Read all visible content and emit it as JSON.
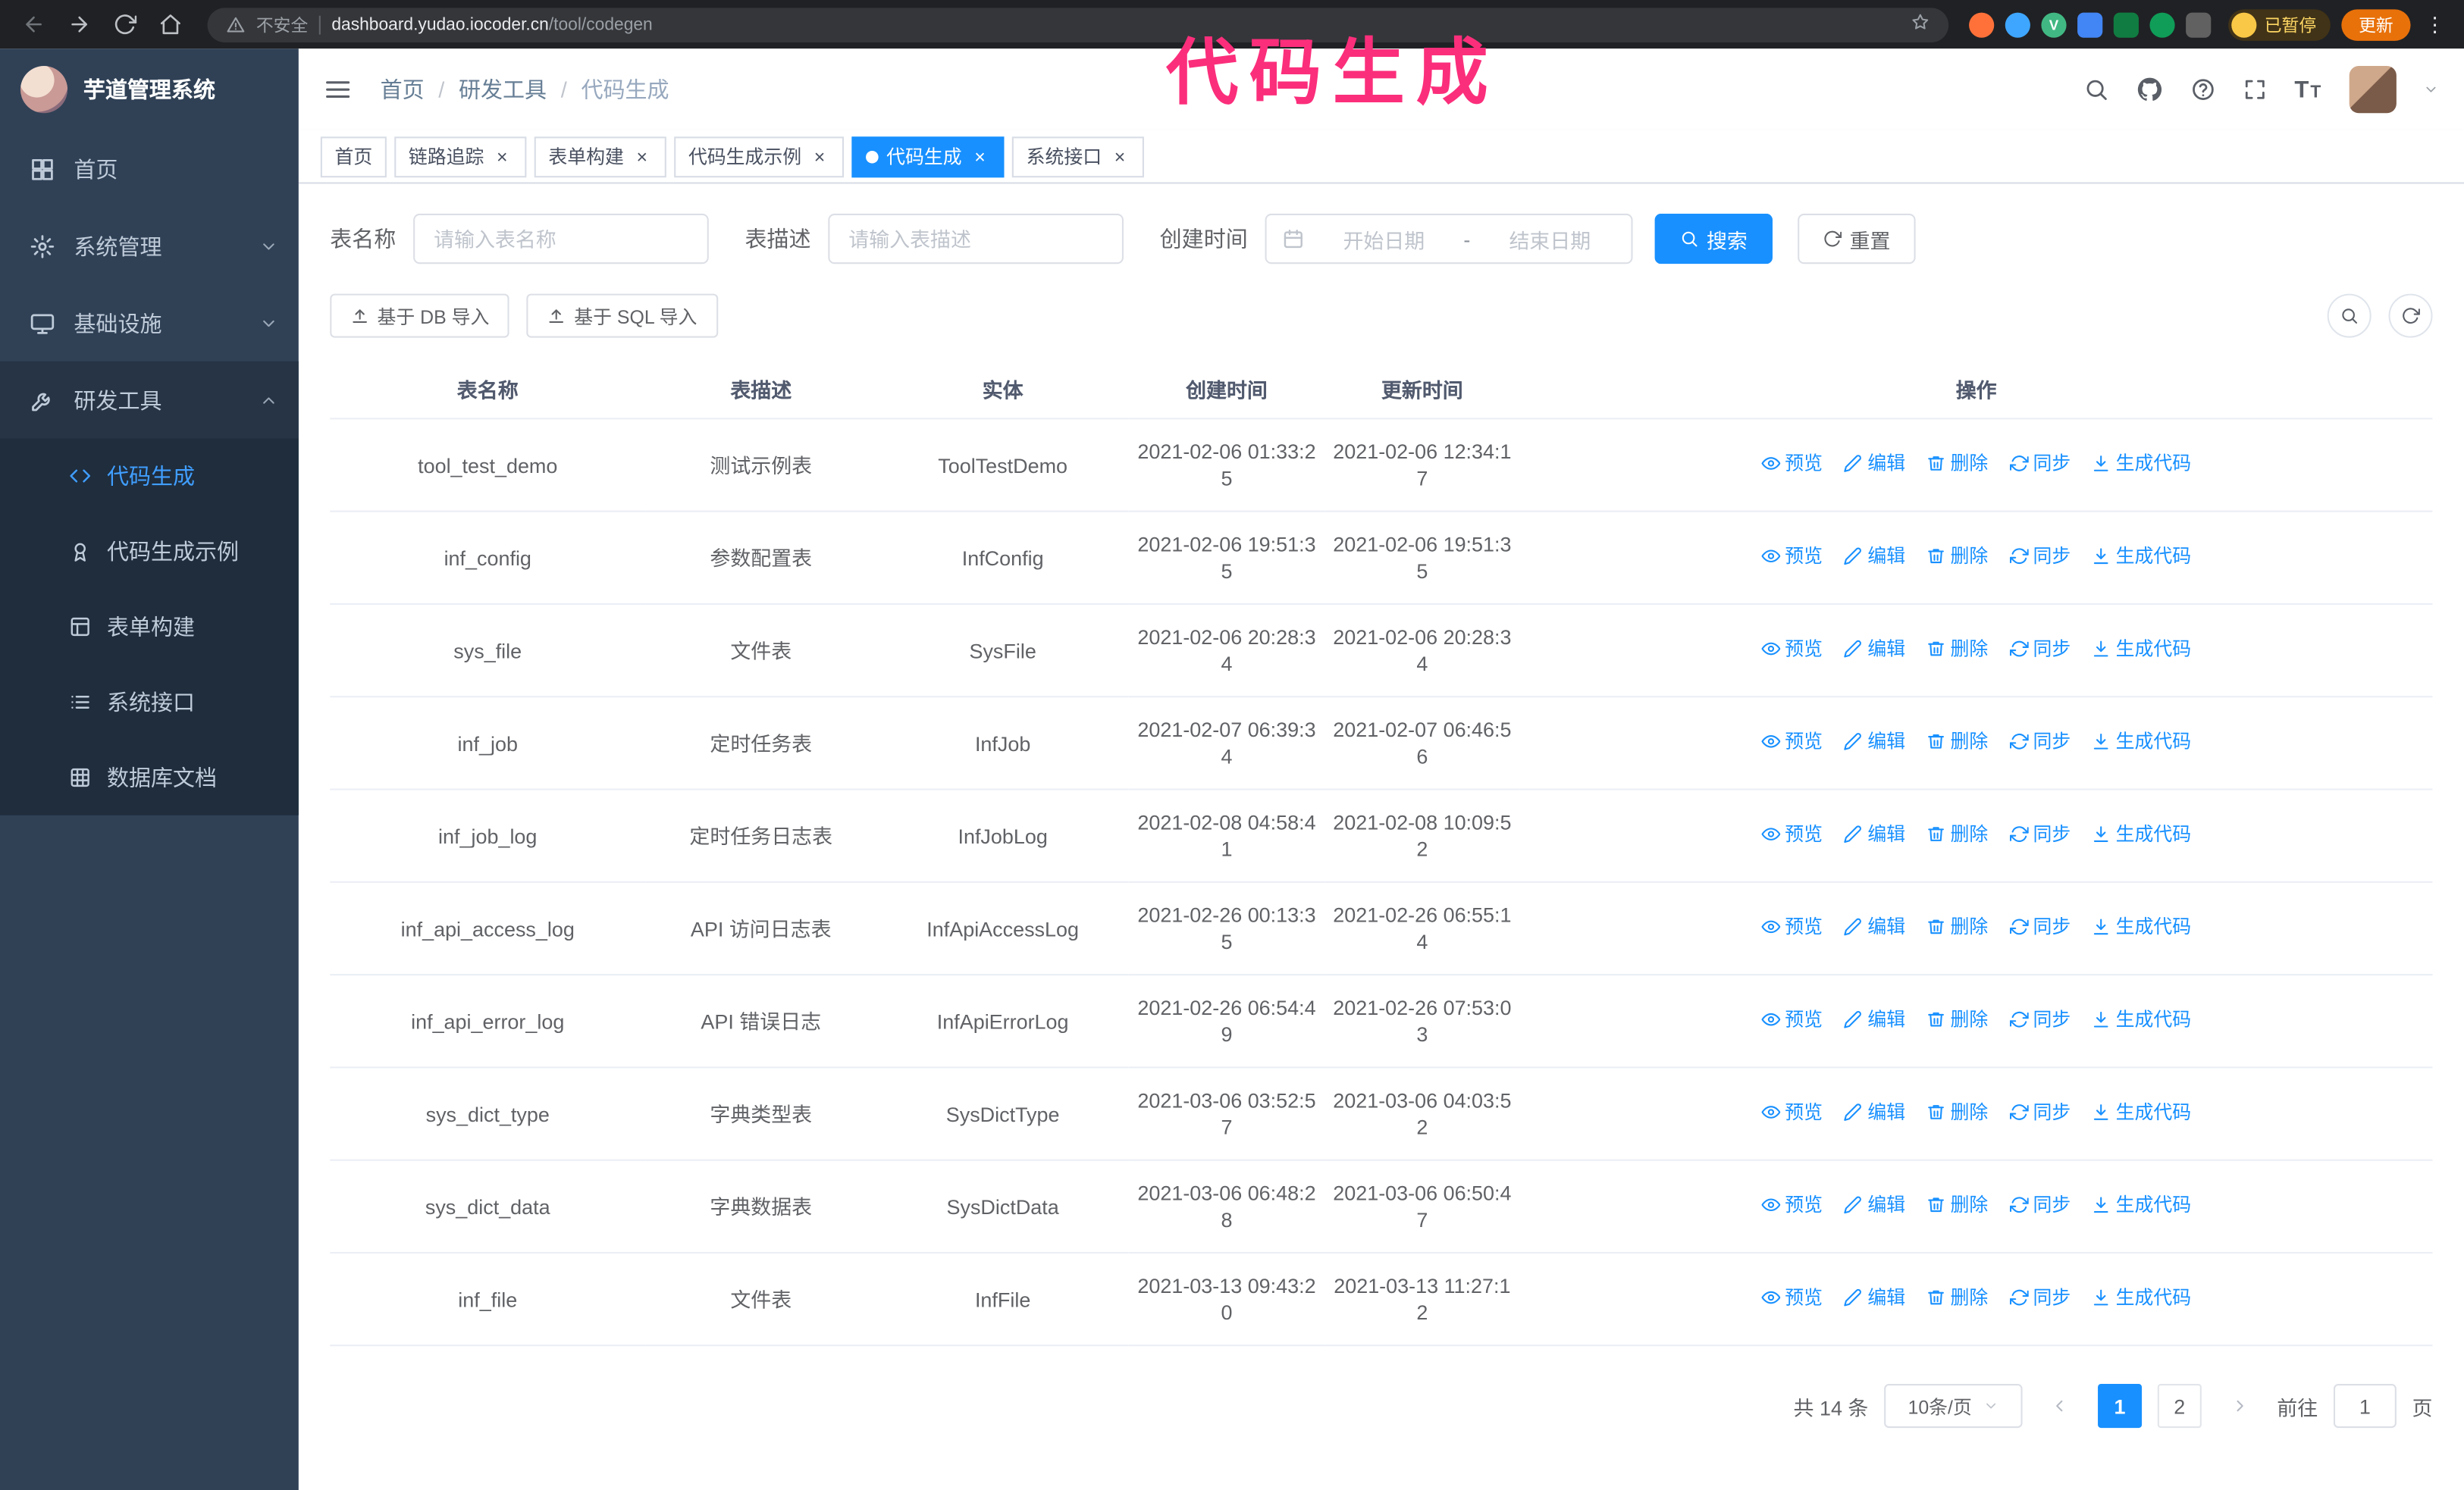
{
  "annotation": "代码生成",
  "colors": {
    "accent": "#1890ff",
    "annotation_pink": "#fb2e7b",
    "sidebar_bg": "#304156",
    "active_tab_bg": "#1890ff"
  },
  "browser": {
    "security_label": "不安全",
    "url_host": "dashboard.yudao.iocoder.cn",
    "url_path": "/tool/codegen",
    "paused_badge": "已暂停",
    "update_button": "更新"
  },
  "app_title": "芋道管理系统",
  "menu": {
    "items": [
      {
        "label": "首页",
        "icon": "grid-icon"
      },
      {
        "label": "系统管理",
        "icon": "gear-icon"
      },
      {
        "label": "基础设施",
        "icon": "monitor-icon"
      },
      {
        "label": "研发工具",
        "icon": "wrench-icon"
      }
    ],
    "children": [
      {
        "label": "代码生成",
        "icon": "code-icon"
      },
      {
        "label": "代码生成示例",
        "icon": "medal-icon"
      },
      {
        "label": "表单构建",
        "icon": "form-icon"
      },
      {
        "label": "系统接口",
        "icon": "list-icon"
      },
      {
        "label": "数据库文档",
        "icon": "grid-table-icon"
      }
    ]
  },
  "breadcrumb": {
    "sep": "/",
    "items": [
      "首页",
      "研发工具",
      "代码生成"
    ]
  },
  "tabs": [
    {
      "label": "首页"
    },
    {
      "label": "链路追踪"
    },
    {
      "label": "表单构建"
    },
    {
      "label": "代码生成示例"
    },
    {
      "label": "代码生成"
    },
    {
      "label": "系统接口"
    }
  ],
  "filter": {
    "table_name_label": "表名称",
    "table_name_placeholder": "请输入表名称",
    "table_desc_label": "表描述",
    "table_desc_placeholder": "请输入表描述",
    "create_time_label": "创建时间",
    "date_start_placeholder": "开始日期",
    "date_separator": "-",
    "date_end_placeholder": "结束日期",
    "search_button": "搜索",
    "reset_button": "重置"
  },
  "toolbar": {
    "import_db_button": "基于 DB 导入",
    "import_sql_button": "基于 SQL 导入"
  },
  "table": {
    "columns": [
      "表名称",
      "表描述",
      "实体",
      "创建时间",
      "更新时间",
      "操作"
    ],
    "actions": [
      {
        "label": "预览",
        "icon": "eye-icon"
      },
      {
        "label": "编辑",
        "icon": "edit-icon"
      },
      {
        "label": "删除",
        "icon": "trash-icon"
      },
      {
        "label": "同步",
        "icon": "sync-icon"
      },
      {
        "label": "生成代码",
        "icon": "download-icon"
      }
    ],
    "rows": [
      {
        "name": "tool_test_demo",
        "desc": "测试示例表",
        "entity": "ToolTestDemo",
        "created": "2021-02-06 01:33:25",
        "updated": "2021-02-06 12:34:17"
      },
      {
        "name": "inf_config",
        "desc": "参数配置表",
        "entity": "InfConfig",
        "created": "2021-02-06 19:51:35",
        "updated": "2021-02-06 19:51:35"
      },
      {
        "name": "sys_file",
        "desc": "文件表",
        "entity": "SysFile",
        "created": "2021-02-06 20:28:34",
        "updated": "2021-02-06 20:28:34"
      },
      {
        "name": "inf_job",
        "desc": "定时任务表",
        "entity": "InfJob",
        "created": "2021-02-07 06:39:34",
        "updated": "2021-02-07 06:46:56"
      },
      {
        "name": "inf_job_log",
        "desc": "定时任务日志表",
        "entity": "InfJobLog",
        "created": "2021-02-08 04:58:41",
        "updated": "2021-02-08 10:09:52"
      },
      {
        "name": "inf_api_access_log",
        "desc": "API 访问日志表",
        "entity": "InfApiAccessLog",
        "created": "2021-02-26 00:13:35",
        "updated": "2021-02-26 06:55:14"
      },
      {
        "name": "inf_api_error_log",
        "desc": "API 错误日志",
        "entity": "InfApiErrorLog",
        "created": "2021-02-26 06:54:49",
        "updated": "2021-02-26 07:53:03"
      },
      {
        "name": "sys_dict_type",
        "desc": "字典类型表",
        "entity": "SysDictType",
        "created": "2021-03-06 03:52:57",
        "updated": "2021-03-06 04:03:52"
      },
      {
        "name": "sys_dict_data",
        "desc": "字典数据表",
        "entity": "SysDictData",
        "created": "2021-03-06 06:48:28",
        "updated": "2021-03-06 06:50:47"
      },
      {
        "name": "inf_file",
        "desc": "文件表",
        "entity": "InfFile",
        "created": "2021-03-13 09:43:20",
        "updated": "2021-03-13 11:27:12"
      }
    ]
  },
  "pagination": {
    "total_text": "共 14 条",
    "page_size": "10条/页",
    "pages": [
      "1",
      "2"
    ],
    "active_page": "1",
    "goto_label": "前往",
    "goto_value": "1",
    "page_unit": "页"
  }
}
